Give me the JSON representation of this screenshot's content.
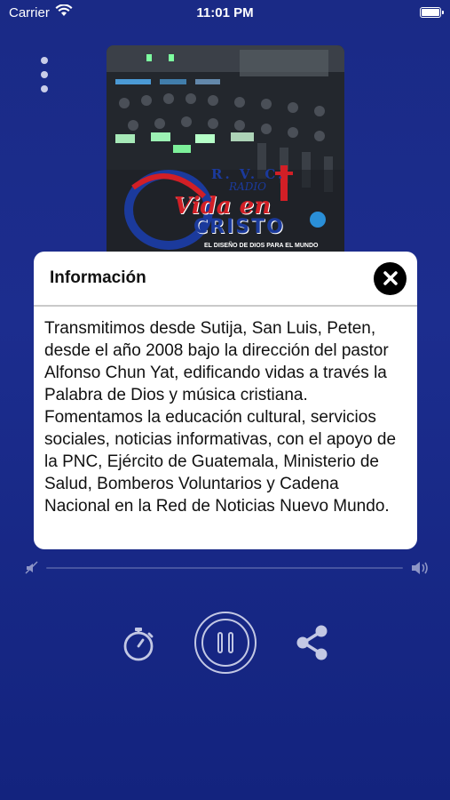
{
  "status_bar": {
    "carrier": "Carrier",
    "time": "11:01 PM",
    "battery_level": 1.0
  },
  "colors": {
    "background_top": "#1a2a86",
    "background_bottom": "#13237e",
    "icon": "#c3c8e4",
    "modal_bg": "#ffffff"
  },
  "cover": {
    "logo_rvc": "R. V. C.",
    "logo_radio": "RADIO",
    "logo_vida": "Vida en",
    "logo_cristo": "CRISTO",
    "logo_slogan": "EL DISEÑO DE DIOS PARA EL MUNDO"
  },
  "modal": {
    "title": "Información",
    "body": "Transmitimos desde Sutija, San Luis, Peten, desde el año 2008 bajo la dirección del pastor Alfonso Chun Yat, edificando vidas a través la Palabra de Dios y música cristiana. Fomentamos la educación cultural, servicios sociales, noticias informativas, con el apoyo de la PNC, Ejército de Guatemala, Ministerio de Salud, Bomberos Voluntarios y Cadena Nacional en la Red de Noticias Nuevo Mundo.",
    "close_icon": "close-icon"
  },
  "player": {
    "volume_level": 0,
    "timer_icon": "stopwatch-icon",
    "play_state_icon": "pause-icon",
    "share_icon": "share-icon"
  }
}
